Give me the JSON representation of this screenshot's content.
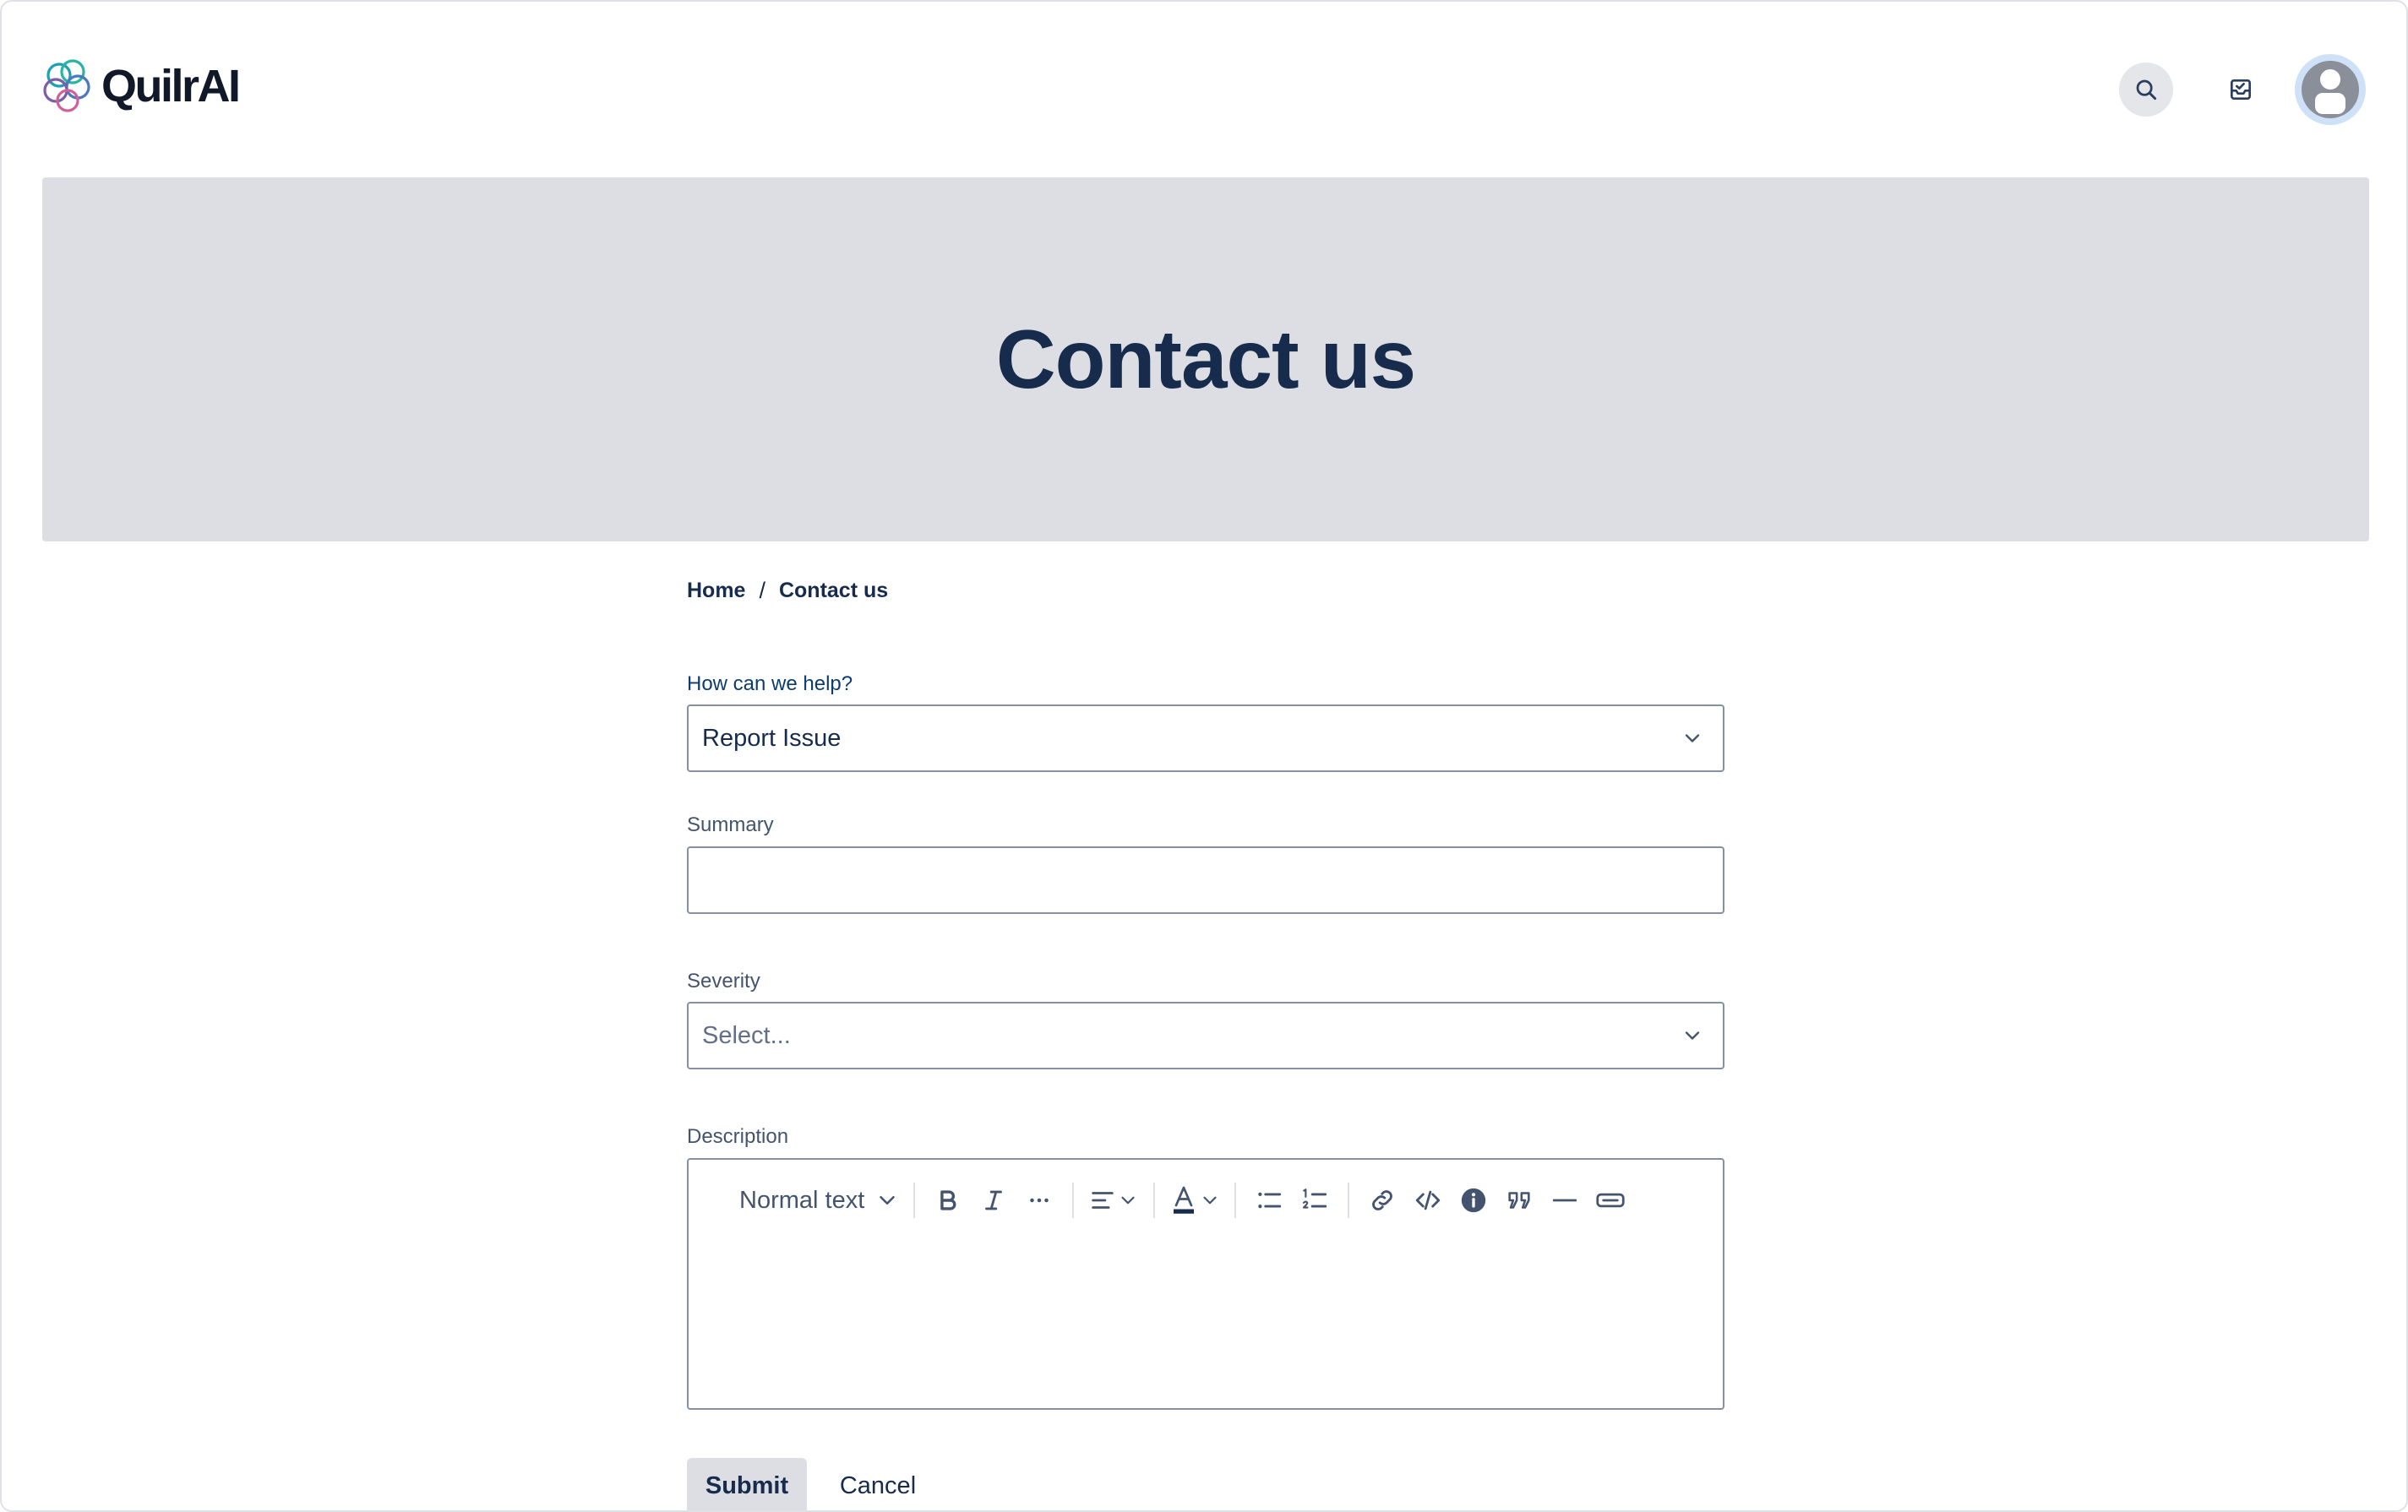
{
  "brand": {
    "name": "QuilrAI",
    "colors": {
      "accent": "#1f9fb4",
      "purple": "#7b5ea7",
      "pink": "#d0609a",
      "text": "#172b4d"
    }
  },
  "header": {
    "search_icon": "search-icon",
    "inbox_icon": "inbox-icon",
    "avatar_icon": "user-avatar-icon"
  },
  "banner": {
    "title": "Contact us",
    "background": "#dddee3"
  },
  "breadcrumb": {
    "items": [
      "Home",
      "Contact us"
    ],
    "separator": "/"
  },
  "form": {
    "help": {
      "label": "How can we help?",
      "value": "Report Issue"
    },
    "summary": {
      "label": "Summary",
      "value": ""
    },
    "severity": {
      "label": "Severity",
      "placeholder": "Select..."
    },
    "description": {
      "label": "Description",
      "toolbar": {
        "text_style": "Normal text",
        "icons": [
          "chevron-down-icon",
          "bold-icon",
          "italic-icon",
          "more-icon",
          "align-icon",
          "text-color-icon",
          "bullet-list-icon",
          "numbered-list-icon",
          "link-icon",
          "code-icon",
          "info-panel-icon",
          "quote-icon",
          "divider-icon",
          "expand-icon"
        ]
      }
    }
  },
  "actions": {
    "submit": "Submit",
    "cancel": "Cancel"
  }
}
